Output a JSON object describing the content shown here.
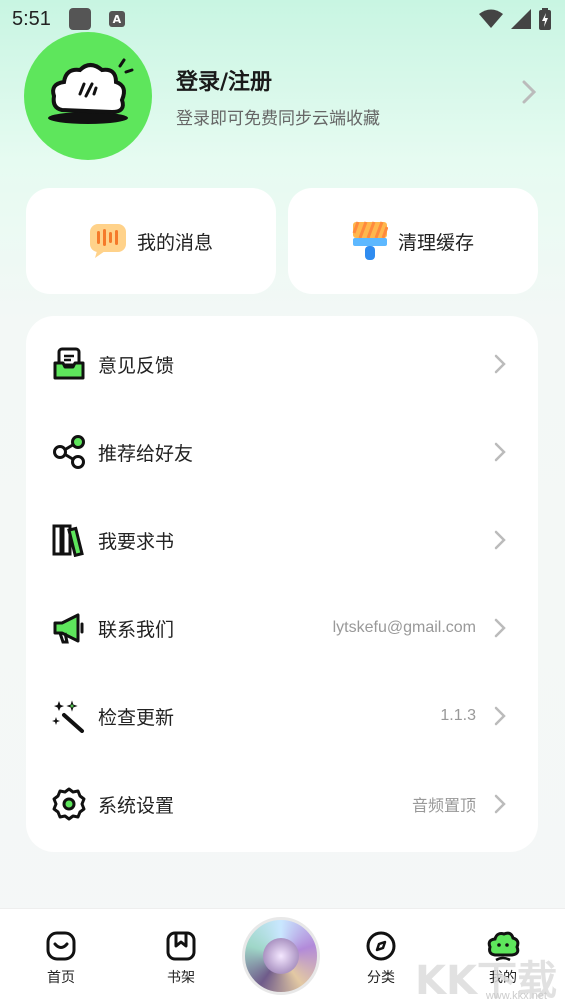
{
  "status_bar": {
    "time": "5:51",
    "notification_icons": [
      "app-icon",
      "a-icon"
    ],
    "right_icons": [
      "wifi-icon",
      "signal-icon",
      "battery-charging-icon"
    ]
  },
  "profile": {
    "title": "登录/注册",
    "subtitle": "登录即可免费同步云端收藏",
    "avatar_color": "#5ee65c"
  },
  "quick_actions": [
    {
      "label": "我的消息",
      "icon": "message-icon"
    },
    {
      "label": "清理缓存",
      "icon": "brush-icon"
    }
  ],
  "menu": [
    {
      "label": "意见反馈",
      "value": "",
      "icon": "feedback-icon"
    },
    {
      "label": "推荐给好友",
      "value": "",
      "icon": "share-icon"
    },
    {
      "label": "我要求书",
      "value": "",
      "icon": "books-icon"
    },
    {
      "label": "联系我们",
      "value": "lytskefu@gmail.com",
      "icon": "megaphone-icon"
    },
    {
      "label": "检查更新",
      "value": "1.1.3",
      "icon": "magic-wand-icon"
    },
    {
      "label": "系统设置",
      "value": "音频置顶",
      "icon": "gear-icon"
    }
  ],
  "bottom_nav": {
    "items": [
      {
        "label": "首页",
        "icon": "home-icon"
      },
      {
        "label": "书架",
        "icon": "bookshelf-icon"
      },
      {
        "label": "",
        "icon": "album-cover"
      },
      {
        "label": "分类",
        "icon": "compass-icon"
      },
      {
        "label": "我的",
        "icon": "profile-cloud-icon",
        "active": true
      }
    ]
  },
  "watermark": {
    "text": "KK下载",
    "url": "www.kkx.net"
  },
  "colors": {
    "accent": "#5ee65c",
    "dark": "#1a1a1a"
  }
}
